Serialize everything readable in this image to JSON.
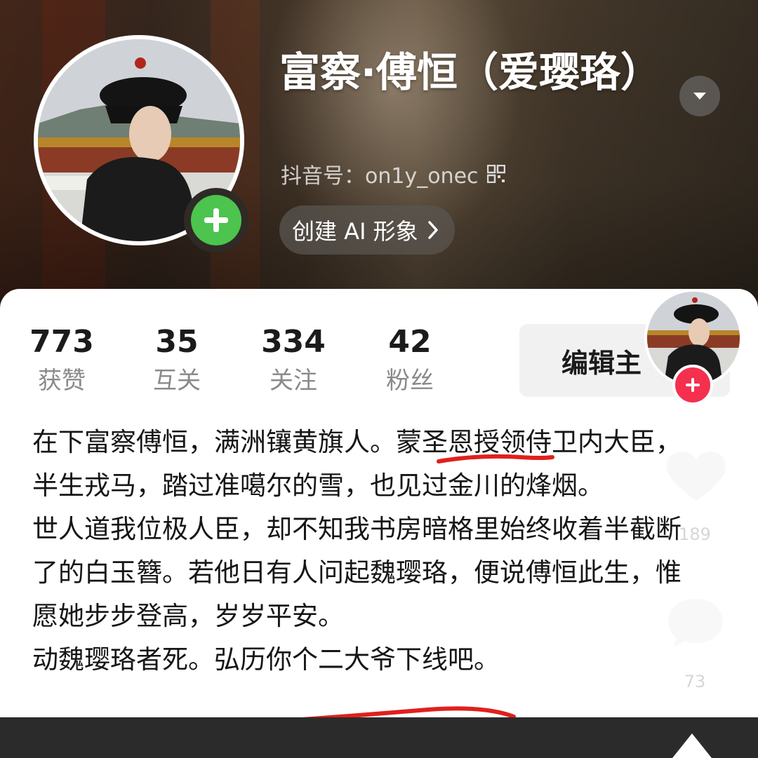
{
  "profile": {
    "display_name": "富察·傅恒（爱璎珞）",
    "douyin_id": "抖音号：on1y_onec",
    "create_ai_label": "创建 AI 形象",
    "edit_label": "编辑主"
  },
  "stats": [
    {
      "value": "773",
      "label": "获赞"
    },
    {
      "value": "35",
      "label": "互关"
    },
    {
      "value": "334",
      "label": "关注"
    },
    {
      "value": "42",
      "label": "粉丝"
    }
  ],
  "bio": {
    "line1": "在下富察傅恒，满洲镶黄旗人。蒙圣恩授领侍卫内大臣，半生戎马，踏过准噶尔的雪，也见过金川的烽烟。",
    "line2": "世人道我位极人臣，却不知我书房暗格里始终收着半截断了的白玉簪。若他日有人问起魏璎珞，便说傅恒此生，惟愿她步步登高，岁岁平安。",
    "line3": "动魏璎珞者死。弘历你个二大爷下线吧。"
  },
  "side_actions": {
    "like_count": "189",
    "comment_count": "73"
  },
  "colors": {
    "accent_green": "#4cc44e",
    "accent_red": "#f5304f",
    "annotation_red": "#e0201c"
  },
  "icons": [
    "plus-icon",
    "dropdown-icon",
    "qr-code-icon",
    "chevron-right-icon",
    "heart-icon",
    "comment-icon",
    "triangle-up-icon"
  ]
}
